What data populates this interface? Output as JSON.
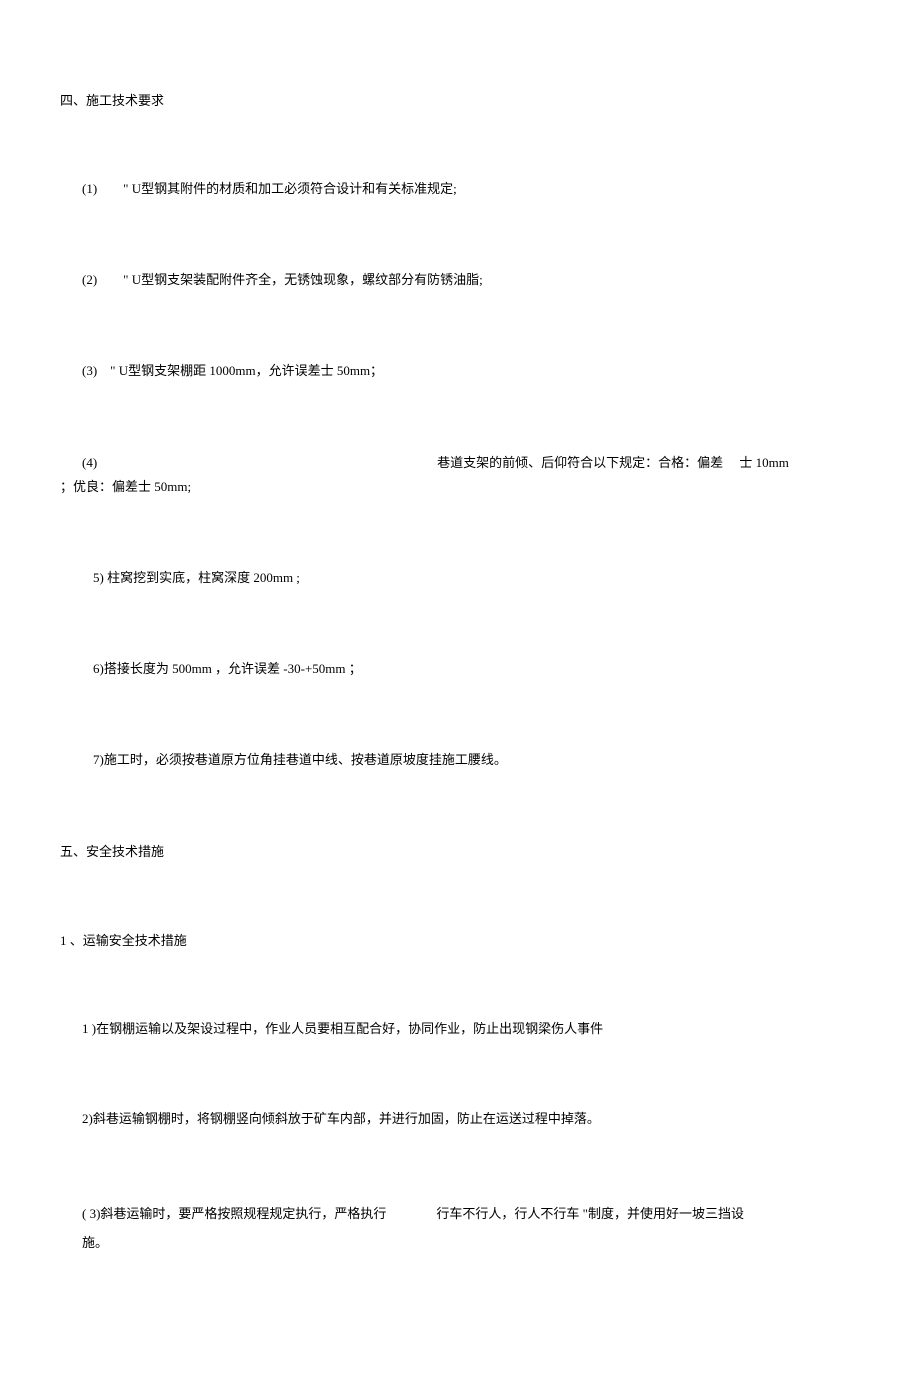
{
  "section4": {
    "heading": "四、施工技术要求",
    "items": [
      "(1)　　\" U型钢其附件的材质和加工必须符合设计和有关标准规定;",
      "(2)　　\" U型钢支架装配附件齐全，无锈蚀现象，螺纹部分有防锈油脂;",
      "(3)　\" U型钢支架棚距 1000mm，允许误差士 50mm；"
    ],
    "item4_prefix": "(4)",
    "item4_main": "巷道支架的前倾、后仰符合以下规定：合格：偏差　 士 10mm",
    "item4_cont": "；优良：偏差士 50mm;",
    "items_indented": [
      "5) 柱窝挖到实底，柱窝深度 200mm ;",
      "6)搭接长度为 500mm ，允许误差 -30-+50mm ；",
      "7)施工时，必须按巷道原方位角挂巷道中线、按巷道原坡度挂施工腰线。"
    ]
  },
  "section5": {
    "heading": "五、安全技术措施",
    "subsection1": {
      "heading": "1 、运输安全技术措施",
      "items": [
        "1 )在钢棚运输以及架设过程中，作业人员要相互配合好，协同作业，防止出现钢梁伤人事件",
        "2)斜巷运输钢棚时，将钢棚竖向倾斜放于矿车内部，并进行加固，防止在运送过程中掉落。"
      ],
      "item3_part1": "( 3)斜巷运输时，要严格按照规程规定执行，严格执行",
      "item3_part2": "行车不行人，行人不行车 \"制度，并使用好一坡三挡设",
      "item3_cont": "施。"
    }
  }
}
